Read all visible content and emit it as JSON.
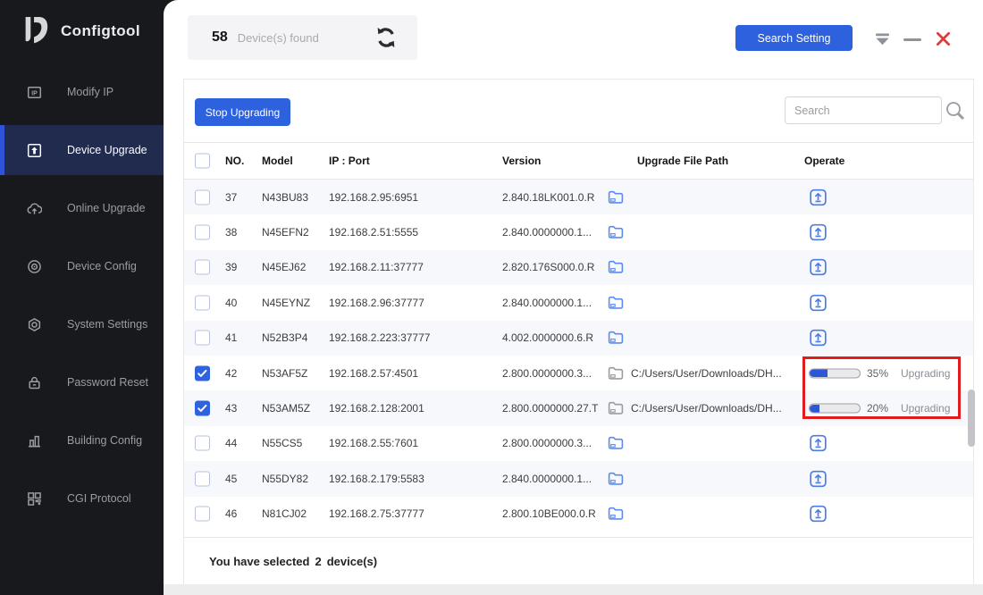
{
  "window": {
    "brand": "Configtool",
    "controls": {
      "search_setting_label": "Search Setting",
      "dropdown_icon": "caret-down-icon",
      "minimize_icon": "minimize-icon",
      "close_icon": "close-icon"
    }
  },
  "sidebar": {
    "items": [
      {
        "label": "Modify IP",
        "icon": "modify-ip-icon",
        "selected": false
      },
      {
        "label": "Device Upgrade",
        "icon": "device-upgrade-icon",
        "selected": true
      },
      {
        "label": "Online Upgrade",
        "icon": "online-upgrade-icon",
        "selected": false
      },
      {
        "label": "Device Config",
        "icon": "device-config-icon",
        "selected": false
      },
      {
        "label": "System Settings",
        "icon": "system-settings-icon",
        "selected": false
      },
      {
        "label": "Password Reset",
        "icon": "password-reset-icon",
        "selected": false
      },
      {
        "label": "Building Config",
        "icon": "building-config-icon",
        "selected": false
      },
      {
        "label": "CGI Protocol",
        "icon": "cgi-protocol-icon",
        "selected": false
      }
    ]
  },
  "header": {
    "device_count": "58",
    "device_count_label": "Device(s) found",
    "refresh_icon": "refresh-icon"
  },
  "toolbar": {
    "stop_button_label": "Stop Upgrading",
    "search_placeholder": "Search",
    "search_value": "",
    "search_icon": "magnifier-icon"
  },
  "table": {
    "columns": [
      "NO.",
      "Model",
      "IP : Port",
      "Version",
      "Upgrade File Path",
      "Operate"
    ],
    "rows": [
      {
        "no": "37",
        "model": "N43BU83",
        "ip": "192.168.2.95:6951",
        "version": "2.840.18LK001.0.R",
        "checked": false,
        "folder_disabled": false,
        "path": "",
        "progress": null,
        "progress_label": "",
        "status": ""
      },
      {
        "no": "38",
        "model": "N45EFN2",
        "ip": "192.168.2.51:5555",
        "version": "2.840.0000000.1...",
        "checked": false,
        "folder_disabled": false,
        "path": "",
        "progress": null,
        "progress_label": "",
        "status": ""
      },
      {
        "no": "39",
        "model": "N45EJ62",
        "ip": "192.168.2.11:37777",
        "version": "2.820.176S000.0.R",
        "checked": false,
        "folder_disabled": false,
        "path": "",
        "progress": null,
        "progress_label": "",
        "status": ""
      },
      {
        "no": "40",
        "model": "N45EYNZ",
        "ip": "192.168.2.96:37777",
        "version": "2.840.0000000.1...",
        "checked": false,
        "folder_disabled": false,
        "path": "",
        "progress": null,
        "progress_label": "",
        "status": ""
      },
      {
        "no": "41",
        "model": "N52B3P4",
        "ip": "192.168.2.223:37777",
        "version": "4.002.0000000.6.R",
        "checked": false,
        "folder_disabled": false,
        "path": "",
        "progress": null,
        "progress_label": "",
        "status": ""
      },
      {
        "no": "42",
        "model": "N53AF5Z",
        "ip": "192.168.2.57:4501",
        "version": "2.800.0000000.3...",
        "checked": true,
        "folder_disabled": true,
        "path": "C:/Users/User/Downloads/DH...",
        "progress": 35,
        "progress_label": "35%",
        "status": "Upgrading"
      },
      {
        "no": "43",
        "model": "N53AM5Z",
        "ip": "192.168.2.128:2001",
        "version": "2.800.0000000.27.T",
        "checked": true,
        "folder_disabled": true,
        "path": "C:/Users/User/Downloads/DH...",
        "progress": 20,
        "progress_label": "20%",
        "status": "Upgrading"
      },
      {
        "no": "44",
        "model": "N55CS5",
        "ip": "192.168.2.55:7601",
        "version": "2.800.0000000.3...",
        "checked": false,
        "folder_disabled": false,
        "path": "",
        "progress": null,
        "progress_label": "",
        "status": ""
      },
      {
        "no": "45",
        "model": "N55DY82",
        "ip": "192.168.2.179:5583",
        "version": "2.840.0000000.1...",
        "checked": false,
        "folder_disabled": false,
        "path": "",
        "progress": null,
        "progress_label": "",
        "status": ""
      },
      {
        "no": "46",
        "model": "N81CJ02",
        "ip": "192.168.2.75:37777",
        "version": "2.800.10BE000.0.R",
        "checked": false,
        "folder_disabled": false,
        "path": "",
        "progress": null,
        "progress_label": "",
        "status": ""
      }
    ]
  },
  "footer": {
    "selected_prefix": "You have selected",
    "selected_count": "2",
    "selected_suffix": "device(s)"
  },
  "colors": {
    "accent_blue": "#2e61de",
    "progress_fill": "#2e57d8",
    "sidebar_bg": "#17191d",
    "sidebar_selected_bg": "#202b4d",
    "sidebar_selected_border": "#2d54d8",
    "annotation_red": "#e01d1d",
    "close_red": "#e23b3b",
    "folder_blue": "#5b8bf0",
    "folder_gray": "#9a9ca1",
    "row_alt_bg": "#f7f8fb"
  }
}
